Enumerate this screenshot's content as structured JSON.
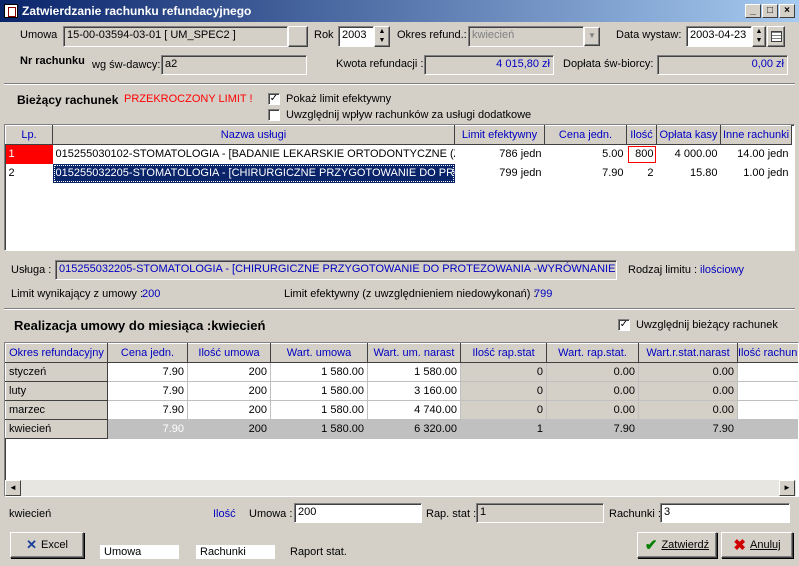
{
  "window": {
    "title": "Zatwierdzanie rachunku refundacyjnego"
  },
  "header": {
    "umowa_label": "Umowa",
    "umowa_value": "15-00-03594-03-01  [ UM_SPEC2 ]",
    "rok_label": "Rok",
    "rok_value": "2003",
    "okres_label": "Okres refund.:",
    "okres_value": "kwiecień",
    "data_label": "Data wystaw:",
    "data_value": "2003-04-23",
    "nr_label": "Nr rachunku",
    "wg_label": "wg św-dawcy:",
    "wg_value": "a2",
    "kwota_label": "Kwota refundacji :",
    "kwota_value": "4 015,80 zł",
    "doplata_label": "Dopłata św-biorcy:",
    "doplata_value": "0,00 zł"
  },
  "current": {
    "title": "Bieżący rachunek",
    "warning": "PRZEKROCZONY LIMIT !",
    "chk1_label": "Pokaż limit efektywny",
    "chk1_mark": "✓",
    "chk2_label": "Uwzględnij wpływ rachunków za usługi dodatkowe"
  },
  "grid1": {
    "headers": [
      "Lp.",
      "Nazwa usługi",
      "Limit efektywny",
      "Cena jedn.",
      "Ilość",
      "Opłata kasy",
      "Inne rachunki"
    ],
    "rows": [
      [
        "1",
        "015255030102-STOMATOLOGIA - [BADANIE LEKARSKIE ORTODONTYCZNE (Z",
        "786 jedn",
        "5.00",
        "800",
        "4 000.00",
        "14.00 jedn"
      ],
      [
        "2",
        "015255032205-STOMATOLOGIA - [CHIRURGICZNE PRZYGOTOWANIE DO PRO",
        "799 jedn",
        "7.90",
        "2",
        "15.80",
        "1.00 jedn"
      ]
    ]
  },
  "detail": {
    "usluga_label": "Usługa :",
    "usluga_value": "015255032205-STOMATOLOGIA - [CHIRURGICZNE PRZYGOTOWANIE DO PROTEZOWANIA -WYRÓWNANIE",
    "rodzaj_label": "Rodzaj limitu :",
    "rodzaj_value": "ilościowy",
    "limit_label": "Limit wynikający z umowy :",
    "limit_value": "200",
    "limit_ef_label": "Limit efektywny (z uwzględnieniem niedowykonań) :",
    "limit_ef_value": "799"
  },
  "realizacja": {
    "title": "Realizacja umowy do miesiąca :kwiecień",
    "chk_label": "Uwzględnij bieżący rachunek",
    "chk_mark": "✓"
  },
  "grid2": {
    "headers": [
      "Okres refundacyjny",
      "Cena jedn.",
      "Ilość umowa",
      "Wart. umowa",
      "Wart. um. narast",
      "Ilość rap.stat",
      "Wart. rap.stat.",
      "Wart.r.stat.narast",
      "Ilość rachunk"
    ],
    "rows": [
      [
        "styczeń",
        "7.90",
        "200",
        "1 580.00",
        "1 580.00",
        "0",
        "0.00",
        "0.00",
        ""
      ],
      [
        "luty",
        "7.90",
        "200",
        "1 580.00",
        "3 160.00",
        "0",
        "0.00",
        "0.00",
        ""
      ],
      [
        "marzec",
        "7.90",
        "200",
        "1 580.00",
        "4 740.00",
        "0",
        "0.00",
        "0.00",
        ""
      ],
      [
        "kwiecień",
        "7.90",
        "200",
        "1 580.00",
        "6 320.00",
        "1",
        "7.90",
        "7.90",
        ""
      ]
    ]
  },
  "bottom": {
    "month": "kwiecień",
    "ilosc": "Ilość",
    "umowa_label": "Umowa :",
    "umowa_value": "200",
    "rap_label": "Rap. stat :",
    "rap_value": "1",
    "rach_label": "Rachunki :",
    "rach_value": "3"
  },
  "footer": {
    "excel": "Excel",
    "legend_umowa": "Umowa",
    "legend_rachunki": "Rachunki",
    "legend_raport": "Raport stat.",
    "zatwierdz": "Zatwierdź",
    "anuluj": "Anuluj"
  }
}
